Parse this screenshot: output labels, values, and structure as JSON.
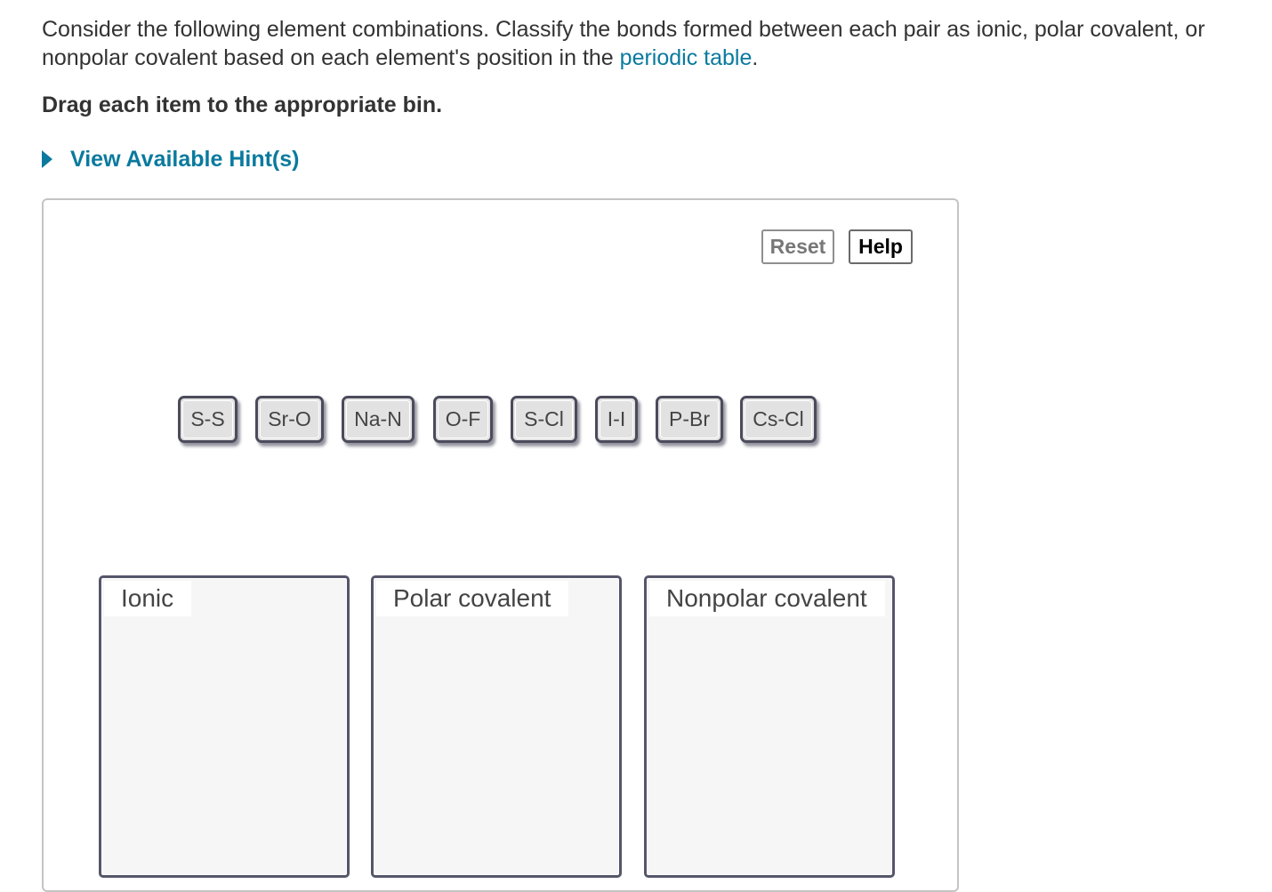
{
  "question": {
    "text_before_link": "Consider the following element combinations. Classify the bonds formed between each pair as ionic, polar covalent, or nonpolar covalent based on each element's position in the ",
    "link_text": "periodic table",
    "text_after_link": "."
  },
  "instruction": "Drag each item to the appropriate bin.",
  "hints": {
    "label": "View Available Hint(s)",
    "icon": "caret-right-icon"
  },
  "toolbar": {
    "reset_label": "Reset",
    "help_label": "Help"
  },
  "tokens": [
    "S-S",
    "Sr-O",
    "Na-N",
    "O-F",
    "S-Cl",
    "I-I",
    "P-Br",
    "Cs-Cl"
  ],
  "bins": [
    {
      "label": "Ionic"
    },
    {
      "label": "Polar covalent"
    },
    {
      "label": "Nonpolar covalent"
    }
  ],
  "colors": {
    "link": "#0a7a9e",
    "text": "#333333",
    "token_fill": "#e2e2e2",
    "token_border": "#4b4b5c",
    "bin_fill": "#f6f6f6"
  }
}
